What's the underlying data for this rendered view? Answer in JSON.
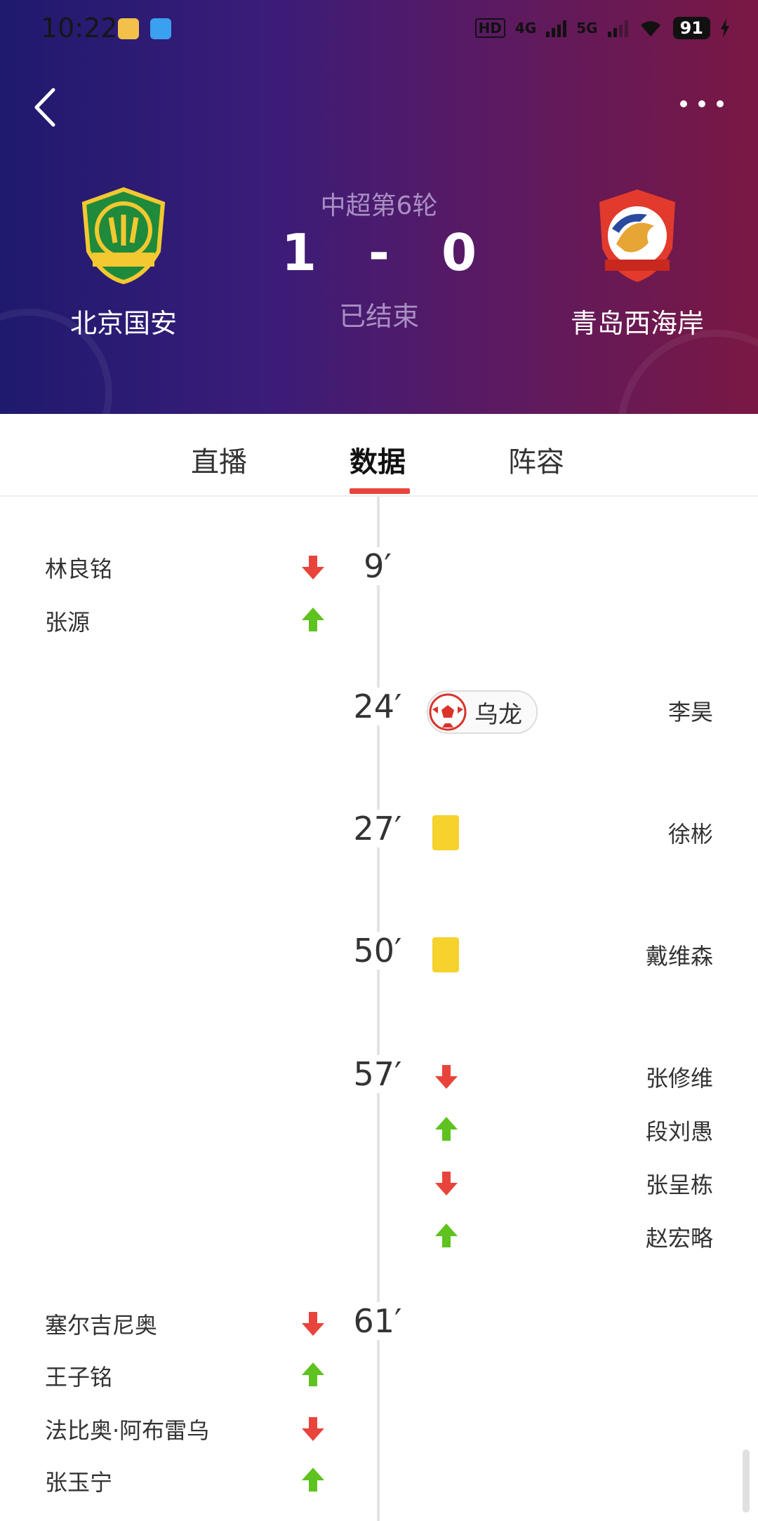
{
  "status_bar": {
    "time": "10:22",
    "battery": "91",
    "net_4g": "4G",
    "net_5g": "5G",
    "hd": "HD"
  },
  "match": {
    "competition": "中超第6轮",
    "home": {
      "name": "北京国安",
      "score": "1"
    },
    "away": {
      "name": "青岛西海岸",
      "score": "0"
    },
    "separator": "-",
    "status": "已结束"
  },
  "tabs": [
    {
      "label": "直播"
    },
    {
      "label": "数据"
    },
    {
      "label": "阵容"
    }
  ],
  "events": {
    "e1": {
      "minute": "9′",
      "out": "林良铭",
      "in": "张源"
    },
    "e2": {
      "minute": "24′",
      "label": "乌龙",
      "player": "李昊"
    },
    "e3": {
      "minute": "27′",
      "player": "徐彬"
    },
    "e4": {
      "minute": "50′",
      "player": "戴维森"
    },
    "e5": {
      "minute": "57′",
      "out1": "张修维",
      "in1": "段刘愚",
      "out2": "张呈栋",
      "in2": "赵宏略"
    },
    "e6": {
      "minute": "61′",
      "out1": "塞尔吉尼奥",
      "in1": "王子铭",
      "out2": "法比奥·阿布雷乌",
      "in2": "张玉宁"
    }
  },
  "colors": {
    "sub_out": "#e8443b",
    "sub_in": "#5ec21f",
    "yellow_card": "#f5d22c",
    "accent": "#e8443b"
  }
}
